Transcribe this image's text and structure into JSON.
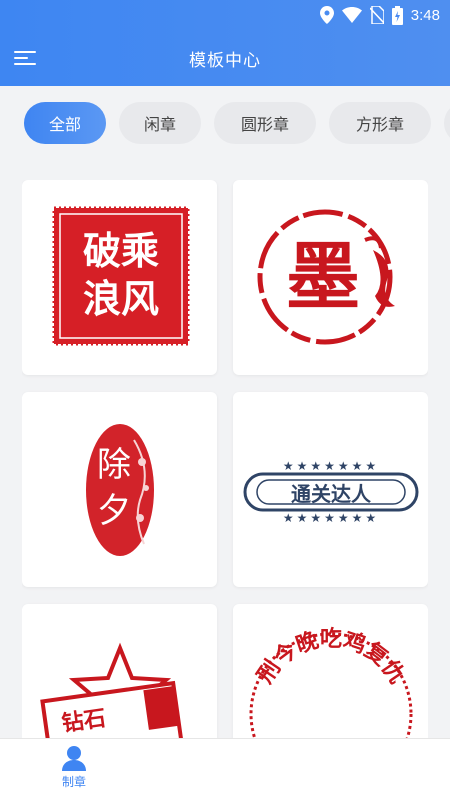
{
  "status_bar": {
    "time": "3:48",
    "icons": [
      "location-icon",
      "wifi-icon",
      "no-sim-icon",
      "battery-charging-icon"
    ]
  },
  "header": {
    "title": "模板中心",
    "menu_icon": "menu-icon"
  },
  "tabs": [
    {
      "label": "全部",
      "active": true
    },
    {
      "label": "闲章",
      "active": false
    },
    {
      "label": "圆形章",
      "active": false
    },
    {
      "label": "方形章",
      "active": false
    }
  ],
  "templates": [
    {
      "name": "破乘浪风",
      "lines": [
        "破乘",
        "浪风"
      ],
      "style": "square",
      "color": "#d61f26"
    },
    {
      "name": "墨",
      "lines": [
        "墨"
      ],
      "style": "round",
      "color": "#c8171e"
    },
    {
      "name": "除夕",
      "lines": [
        "除",
        "夕"
      ],
      "style": "oval",
      "color": "#d2232a"
    },
    {
      "name": "通关达人",
      "lines": [
        "通关达人"
      ],
      "style": "banner",
      "color": "#2f4466"
    },
    {
      "name": "钻石",
      "lines": [
        "钻石"
      ],
      "style": "star",
      "color": "#c8171e"
    },
    {
      "name": "刑今晚吃鸡复仇",
      "lines": [
        "刑今晚吃鸡复仇"
      ],
      "style": "arc",
      "color": "#c8171e"
    }
  ],
  "bottom_nav": {
    "items": [
      {
        "label": "制章",
        "icon": "user-icon",
        "active": true
      }
    ]
  },
  "colors": {
    "primary": "#3f85f2",
    "seal_red": "#d61f26",
    "seal_blue": "#2f4466"
  }
}
